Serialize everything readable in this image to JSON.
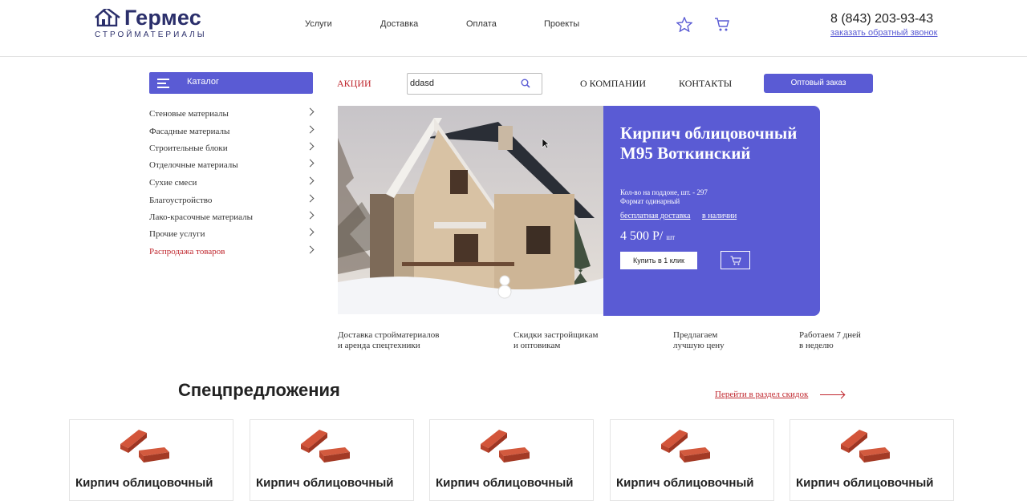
{
  "header": {
    "logo_name": "Гермес",
    "logo_sub": "СТРОЙМАТЕРИАЛЫ",
    "nav": [
      "Услуги",
      "Доставка",
      "Оплата",
      "Проекты"
    ],
    "phone": "8 (843) 203-93-43",
    "callback": "заказать обратный звонок"
  },
  "toolbar": {
    "catalog_label": "Каталог",
    "akcii": "АКЦИИ",
    "search_value": "ddasd",
    "about": "О КОМПАНИИ",
    "contacts": "КОНТАКТЫ",
    "wholesale": "Оптовый заказ"
  },
  "catalog": [
    "Стеновые материалы",
    "Фасадные материалы",
    "Строительные блоки",
    "Отделочные материалы",
    "Сухие смеси",
    "Благоустройство",
    "Лако-красочные материалы",
    "Прочие услуги",
    "Распродажа товаров"
  ],
  "hero": {
    "title": "Кирпич облицовочный М95 Воткинский",
    "qty": "Кол-во на поддоне, шт. - 297",
    "format": "Формат одинарный",
    "free_delivery": "бесплатная доставка",
    "in_stock": "в наличии",
    "price": "4 500 Р/",
    "unit": "шт",
    "buy": "Купить в 1 клик"
  },
  "features": [
    [
      "Доставка стройматериалов",
      "и аренда спецтехники"
    ],
    [
      "Скидки застройщикам",
      "и оптовикам"
    ],
    [
      "Предлагаем",
      "лучшую цену"
    ],
    [
      "Работаем 7 дней",
      "в неделю"
    ]
  ],
  "specials": {
    "title": "Спецпредложения",
    "link": "Перейти в раздел скидок",
    "cards": [
      "Кирпич облицовочный",
      "Кирпич облицовочный",
      "Кирпич облицовочный",
      "Кирпич облицовочный",
      "Кирпич облицовочный"
    ]
  },
  "colors": {
    "accent": "#5a5bd4",
    "sale": "#c0282f",
    "brand": "#2b2f6b"
  }
}
